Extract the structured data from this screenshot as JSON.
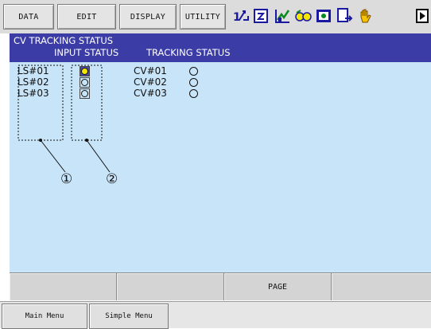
{
  "menu": {
    "data": "DATA",
    "edit": "EDIT",
    "display": "DISPLAY",
    "utility": "UTILITY"
  },
  "toolbar_icons": [
    "axis-swap-icon",
    "edit-sheet-icon",
    "chart-icon",
    "glasses-icon",
    "image-icon",
    "document-arrow-icon",
    "hand-icon",
    "play-icon"
  ],
  "screen": {
    "title": "CV TRACKING STATUS",
    "input_header": "INPUT STATUS",
    "tracking_header": "TRACKING STATUS"
  },
  "limit_switches": [
    {
      "label": "LS#01",
      "active": true
    },
    {
      "label": "LS#02",
      "active": false
    },
    {
      "label": "LS#03",
      "active": false
    }
  ],
  "conveyors": [
    {
      "label": "CV#01",
      "tracking": false
    },
    {
      "label": "CV#02",
      "tracking": false
    },
    {
      "label": "CV#03",
      "tracking": false
    }
  ],
  "callouts": [
    "①",
    "②"
  ],
  "function_keys": [
    "",
    "",
    "PAGE",
    ""
  ],
  "bottom": {
    "main_menu": "Main Menu",
    "simple_menu": "Simple Menu"
  },
  "colors": {
    "title_bar": "#3c3ca6",
    "content_bg": "#c8e4f8",
    "active_lamp": "#f5e600"
  }
}
